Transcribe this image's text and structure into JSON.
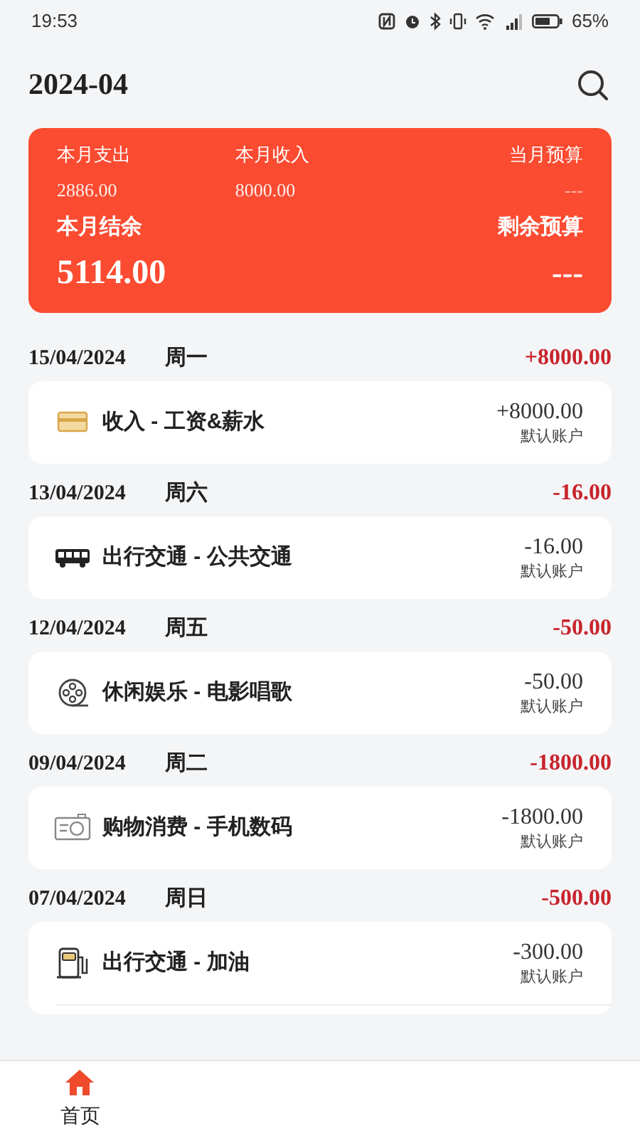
{
  "status_bar": {
    "time": "19:53",
    "battery": "65%"
  },
  "header": {
    "title": "2024-04"
  },
  "summary": {
    "expense_label": "本月支出",
    "expense": "2886.00",
    "income_label": "本月收入",
    "income": "8000.00",
    "budget_label": "当月预算",
    "budget": "---",
    "balance_label": "本月结余",
    "balance": "5114.00",
    "remaining_label": "剩余预算",
    "remaining": "---"
  },
  "groups": [
    {
      "date": "15/04/2024",
      "weekday": "周一",
      "total": "+8000.00",
      "continues": false,
      "items": [
        {
          "kind": "card",
          "title": "收入 - 工资&薪水",
          "amount": "+8000.00",
          "account": "默认账户"
        }
      ]
    },
    {
      "date": "13/04/2024",
      "weekday": "周六",
      "total": "-16.00",
      "continues": false,
      "items": [
        {
          "kind": "bus",
          "title": "出行交通 - 公共交通",
          "amount": "-16.00",
          "account": "默认账户"
        }
      ]
    },
    {
      "date": "12/04/2024",
      "weekday": "周五",
      "total": "-50.00",
      "continues": false,
      "items": [
        {
          "kind": "film",
          "title": "休闲娱乐 - 电影唱歌",
          "amount": "-50.00",
          "account": "默认账户"
        }
      ]
    },
    {
      "date": "09/04/2024",
      "weekday": "周二",
      "total": "-1800.00",
      "continues": false,
      "items": [
        {
          "kind": "camera",
          "title": "购物消费 - 手机数码",
          "amount": "-1800.00",
          "account": "默认账户"
        }
      ]
    },
    {
      "date": "07/04/2024",
      "weekday": "周日",
      "total": "-500.00",
      "continues": true,
      "items": [
        {
          "kind": "fuel",
          "title": "出行交通 - 加油",
          "amount": "-300.00",
          "account": "默认账户"
        }
      ]
    }
  ],
  "nav": [
    {
      "kind": "home",
      "label": "首页",
      "selected": true
    }
  ]
}
